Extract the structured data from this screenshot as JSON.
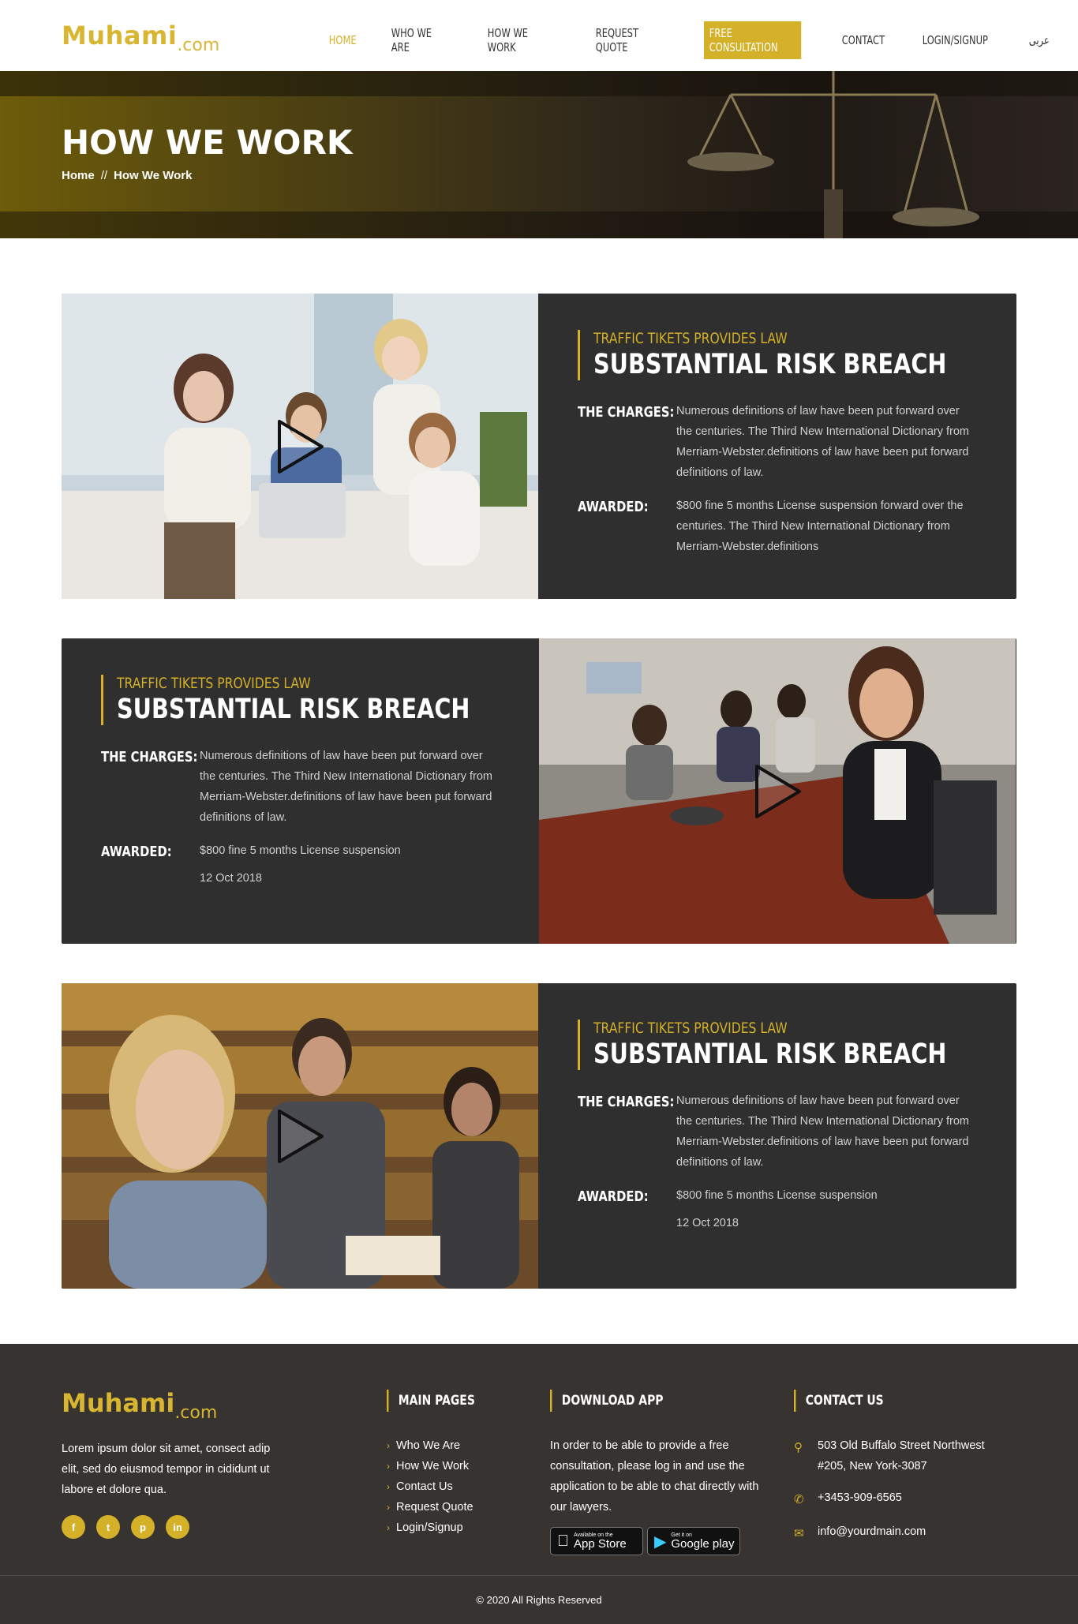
{
  "brand": {
    "logo_main": "Muhami",
    "logo_suffix": ".com"
  },
  "nav": {
    "items": [
      {
        "label": "HOME"
      },
      {
        "label": "WHO WE ARE"
      },
      {
        "label": "HOW WE WORK"
      },
      {
        "label": "REQUEST QUOTE"
      },
      {
        "label": "FREE CONSULTATION"
      },
      {
        "label": "CONTACT"
      },
      {
        "label": "LOGIN/SIGNUP"
      },
      {
        "label": "عربى"
      }
    ]
  },
  "banner": {
    "title": "HOW WE WORK",
    "crumb_home": "Home",
    "crumb_sep": "//",
    "crumb_current": "How We Work"
  },
  "cases": [
    {
      "subtitle": "TRAFFIC TIKETS PROVIDES LAW",
      "title": "SUBSTANTIAL RISK BREACH",
      "charges_label": "THE CHARGES:",
      "charges": "Numerous definitions of law have been put forward over the centuries. The Third New International Dictionary from Merriam-Webster.definitions of law have been put forward definitions of law.",
      "awarded_label": "AWARDED:",
      "awarded": "$800 fine 5 months License suspension forward over the centuries. The Third New International Dictionary from Merriam-Webster.definitions",
      "date": ""
    },
    {
      "subtitle": "TRAFFIC TIKETS PROVIDES LAW",
      "title": "SUBSTANTIAL RISK BREACH",
      "charges_label": "THE CHARGES:",
      "charges": "Numerous definitions of law have been put forward over the centuries. The Third New International Dictionary from Merriam-Webster.definitions of law have been put forward definitions of law.",
      "awarded_label": "AWARDED:",
      "awarded": "$800 fine 5 months License suspension",
      "date": "12 Oct 2018"
    },
    {
      "subtitle": "TRAFFIC TIKETS PROVIDES LAW",
      "title": "SUBSTANTIAL RISK BREACH",
      "charges_label": "THE CHARGES:",
      "charges": "Numerous definitions of law have been put forward over the centuries. The Third New International Dictionary from Merriam-Webster.definitions of law have been put forward definitions of law.",
      "awarded_label": "AWARDED:",
      "awarded": "$800 fine 5 months License suspension",
      "date": "12 Oct 2018"
    }
  ],
  "footer": {
    "about": "Lorem ipsum dolor sit amet, consect adip elit, sed do eiusmod tempor in cididunt ut labore et dolore qua.",
    "social": [
      "f",
      "t",
      "p",
      "in"
    ],
    "main_pages_title": "MAIN PAGES",
    "main_pages": [
      "Who We Are",
      "How We Work",
      "Contact Us",
      "Request Quote",
      "Login/Signup"
    ],
    "download_title": "DOWNLOAD APP",
    "download_text": "In order to be able to provide a free consultation, please log in and use the application to be able to chat directly with our lawyers.",
    "appstore_small": "Available on the",
    "appstore_big": "App Store",
    "play_small": "Get it on",
    "play_big": "Google play",
    "contact_title": "CONTACT US",
    "address": "503 Old Buffalo Street Northwest #205, New York-3087",
    "phone": "+3453-909-6565",
    "email": "info@yourdmain.com",
    "copyright": "© 2020 All Rights Reserved"
  },
  "colors": {
    "accent": "#d4b128",
    "dark_panel": "#2f2f2f",
    "footer_bg": "#363330"
  }
}
